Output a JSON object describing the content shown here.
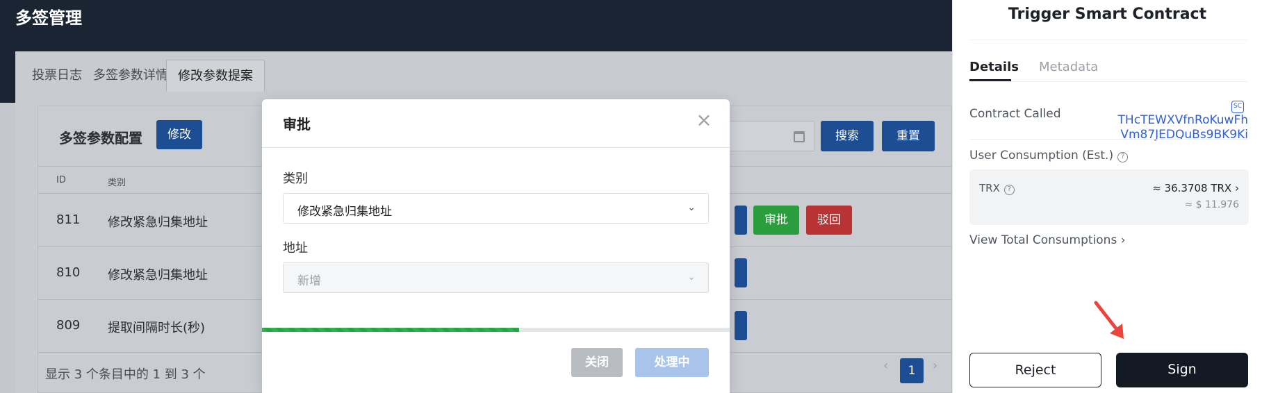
{
  "app": {
    "title": "多签管理"
  },
  "tabs": [
    {
      "label": "投票日志"
    },
    {
      "label": "多签参数详情"
    },
    {
      "label": "修改参数提案"
    }
  ],
  "panel": {
    "title": "多签参数配置",
    "edit_label": "修改",
    "search_label": "搜索",
    "reset_label": "重置",
    "columns": [
      "ID",
      "类别"
    ],
    "rows": [
      {
        "id": "811",
        "category": "修改紧急归集地址",
        "approve": "审批",
        "reject": "驳回"
      },
      {
        "id": "810",
        "category": "修改紧急归集地址"
      },
      {
        "id": "809",
        "category": "提取间隔时长(秒)"
      }
    ],
    "footer": "显示 3 个条目中的 1 到 3 个",
    "page": "1"
  },
  "modal": {
    "title": "审批",
    "close_glyph": "×",
    "category_label": "类别",
    "category_value": "修改紧急归集地址",
    "address_label": "地址",
    "address_value": "新增",
    "progress": 0.55,
    "close_label": "关闭",
    "processing_label": "处理中"
  },
  "wallet": {
    "title": "Trigger Smart Contract",
    "tab_details": "Details",
    "tab_metadata": "Metadata",
    "contract_called_label": "Contract Called",
    "sc_badge": "SC",
    "contract_address_1": "THcTEWXVfnRoKuwFh",
    "contract_address_2": "Vm87JEDQuBs9BK9Ki",
    "consumption_label": "User Consumption (Est.)",
    "trx_label": "TRX",
    "trx_value": "≈ 36.3708 TRX",
    "usd_value": "≈ $ 11.976",
    "view_total": "View Total Consumptions",
    "reject_label": "Reject",
    "sign_label": "Sign"
  },
  "colors": {
    "topbar": "#1b2433",
    "primary_blue": "#1d4e94",
    "approve_green": "#2a9d3d",
    "reject_red": "#b83434",
    "link_blue": "#2e5fd8",
    "sign_dark": "#141a24",
    "arrow_red": "#e8453c"
  }
}
